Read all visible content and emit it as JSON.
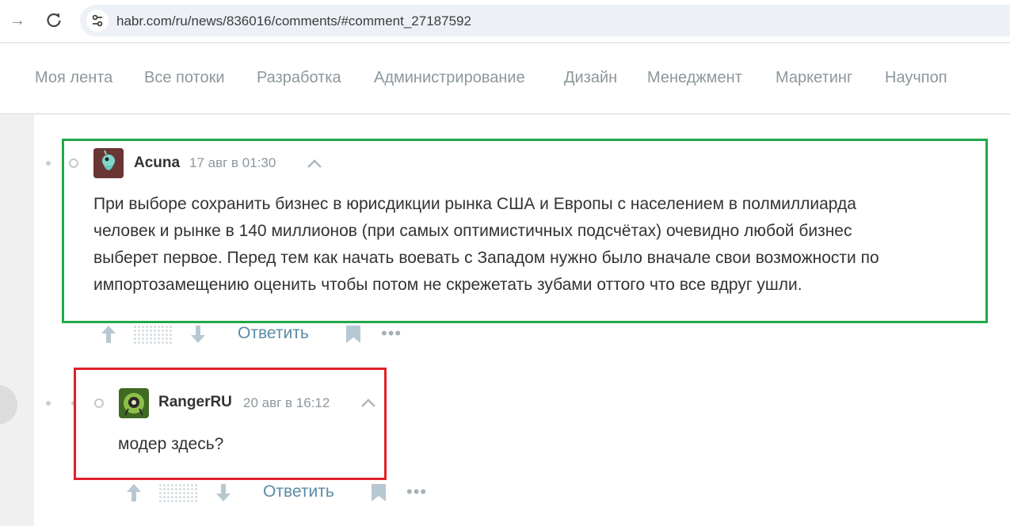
{
  "browser": {
    "url": "habr.com/ru/news/836016/comments/#comment_27187592",
    "forward_icon": "arrow-right-icon",
    "reload_icon": "reload-icon",
    "site_info_icon": "tune-icon"
  },
  "hubs": [
    "Моя лента",
    "Все потоки",
    "Разработка",
    "Администрирование",
    "Дизайн",
    "Менеджмент",
    "Маркетинг",
    "Научпоп"
  ],
  "comments": [
    {
      "author": "Acuna",
      "time": "17 авг в 01:30",
      "lines": [
        "При выборе сохранить бизнес в юрисдикции рынка США и Европы с населением в полмиллиарда",
        "человек и рынке в 140 миллионов (при самых оптимистичных подсчётах) очевидно любой бизнес",
        "выберет первое. Перед тем как начать воевать с Западом нужно было вначале свои возможности по",
        "импортозамещению оценить чтобы потом не скрежетать зубами оттого что все вдруг ушли."
      ],
      "reply_label": "Ответить",
      "more_label": "•••"
    },
    {
      "author": "RangerRU",
      "time": "20 авг в 16:12",
      "lines": [
        "модер здесь?"
      ],
      "reply_label": "Ответить",
      "more_label": "•••"
    }
  ],
  "colors": {
    "highlight_green": "#22a84a",
    "highlight_red": "#e0202a",
    "reply_link": "#5a8ba5"
  }
}
